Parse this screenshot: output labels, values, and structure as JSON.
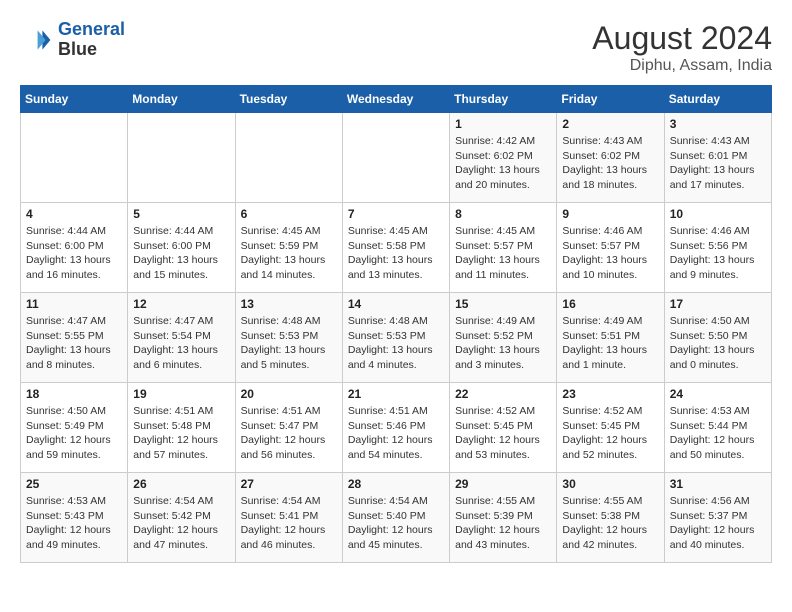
{
  "header": {
    "logo_line1": "General",
    "logo_line2": "Blue",
    "title": "August 2024",
    "subtitle": "Diphu, Assam, India"
  },
  "weekdays": [
    "Sunday",
    "Monday",
    "Tuesday",
    "Wednesday",
    "Thursday",
    "Friday",
    "Saturday"
  ],
  "weeks": [
    [
      {
        "day": "",
        "info": ""
      },
      {
        "day": "",
        "info": ""
      },
      {
        "day": "",
        "info": ""
      },
      {
        "day": "",
        "info": ""
      },
      {
        "day": "1",
        "info": "Sunrise: 4:42 AM\nSunset: 6:02 PM\nDaylight: 13 hours\nand 20 minutes."
      },
      {
        "day": "2",
        "info": "Sunrise: 4:43 AM\nSunset: 6:02 PM\nDaylight: 13 hours\nand 18 minutes."
      },
      {
        "day": "3",
        "info": "Sunrise: 4:43 AM\nSunset: 6:01 PM\nDaylight: 13 hours\nand 17 minutes."
      }
    ],
    [
      {
        "day": "4",
        "info": "Sunrise: 4:44 AM\nSunset: 6:00 PM\nDaylight: 13 hours\nand 16 minutes."
      },
      {
        "day": "5",
        "info": "Sunrise: 4:44 AM\nSunset: 6:00 PM\nDaylight: 13 hours\nand 15 minutes."
      },
      {
        "day": "6",
        "info": "Sunrise: 4:45 AM\nSunset: 5:59 PM\nDaylight: 13 hours\nand 14 minutes."
      },
      {
        "day": "7",
        "info": "Sunrise: 4:45 AM\nSunset: 5:58 PM\nDaylight: 13 hours\nand 13 minutes."
      },
      {
        "day": "8",
        "info": "Sunrise: 4:45 AM\nSunset: 5:57 PM\nDaylight: 13 hours\nand 11 minutes."
      },
      {
        "day": "9",
        "info": "Sunrise: 4:46 AM\nSunset: 5:57 PM\nDaylight: 13 hours\nand 10 minutes."
      },
      {
        "day": "10",
        "info": "Sunrise: 4:46 AM\nSunset: 5:56 PM\nDaylight: 13 hours\nand 9 minutes."
      }
    ],
    [
      {
        "day": "11",
        "info": "Sunrise: 4:47 AM\nSunset: 5:55 PM\nDaylight: 13 hours\nand 8 minutes."
      },
      {
        "day": "12",
        "info": "Sunrise: 4:47 AM\nSunset: 5:54 PM\nDaylight: 13 hours\nand 6 minutes."
      },
      {
        "day": "13",
        "info": "Sunrise: 4:48 AM\nSunset: 5:53 PM\nDaylight: 13 hours\nand 5 minutes."
      },
      {
        "day": "14",
        "info": "Sunrise: 4:48 AM\nSunset: 5:53 PM\nDaylight: 13 hours\nand 4 minutes."
      },
      {
        "day": "15",
        "info": "Sunrise: 4:49 AM\nSunset: 5:52 PM\nDaylight: 13 hours\nand 3 minutes."
      },
      {
        "day": "16",
        "info": "Sunrise: 4:49 AM\nSunset: 5:51 PM\nDaylight: 13 hours\nand 1 minute."
      },
      {
        "day": "17",
        "info": "Sunrise: 4:50 AM\nSunset: 5:50 PM\nDaylight: 13 hours\nand 0 minutes."
      }
    ],
    [
      {
        "day": "18",
        "info": "Sunrise: 4:50 AM\nSunset: 5:49 PM\nDaylight: 12 hours\nand 59 minutes."
      },
      {
        "day": "19",
        "info": "Sunrise: 4:51 AM\nSunset: 5:48 PM\nDaylight: 12 hours\nand 57 minutes."
      },
      {
        "day": "20",
        "info": "Sunrise: 4:51 AM\nSunset: 5:47 PM\nDaylight: 12 hours\nand 56 minutes."
      },
      {
        "day": "21",
        "info": "Sunrise: 4:51 AM\nSunset: 5:46 PM\nDaylight: 12 hours\nand 54 minutes."
      },
      {
        "day": "22",
        "info": "Sunrise: 4:52 AM\nSunset: 5:45 PM\nDaylight: 12 hours\nand 53 minutes."
      },
      {
        "day": "23",
        "info": "Sunrise: 4:52 AM\nSunset: 5:45 PM\nDaylight: 12 hours\nand 52 minutes."
      },
      {
        "day": "24",
        "info": "Sunrise: 4:53 AM\nSunset: 5:44 PM\nDaylight: 12 hours\nand 50 minutes."
      }
    ],
    [
      {
        "day": "25",
        "info": "Sunrise: 4:53 AM\nSunset: 5:43 PM\nDaylight: 12 hours\nand 49 minutes."
      },
      {
        "day": "26",
        "info": "Sunrise: 4:54 AM\nSunset: 5:42 PM\nDaylight: 12 hours\nand 47 minutes."
      },
      {
        "day": "27",
        "info": "Sunrise: 4:54 AM\nSunset: 5:41 PM\nDaylight: 12 hours\nand 46 minutes."
      },
      {
        "day": "28",
        "info": "Sunrise: 4:54 AM\nSunset: 5:40 PM\nDaylight: 12 hours\nand 45 minutes."
      },
      {
        "day": "29",
        "info": "Sunrise: 4:55 AM\nSunset: 5:39 PM\nDaylight: 12 hours\nand 43 minutes."
      },
      {
        "day": "30",
        "info": "Sunrise: 4:55 AM\nSunset: 5:38 PM\nDaylight: 12 hours\nand 42 minutes."
      },
      {
        "day": "31",
        "info": "Sunrise: 4:56 AM\nSunset: 5:37 PM\nDaylight: 12 hours\nand 40 minutes."
      }
    ]
  ]
}
